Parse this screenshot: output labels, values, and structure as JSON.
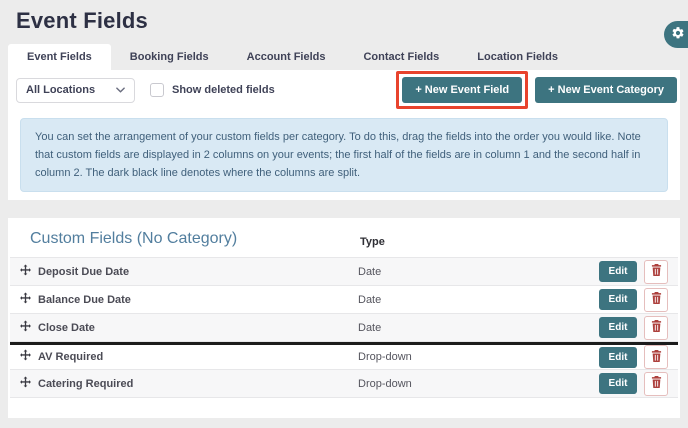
{
  "page": {
    "title": "Event Fields"
  },
  "tabs": [
    {
      "label": "Event Fields",
      "active": true
    },
    {
      "label": "Booking Fields",
      "active": false
    },
    {
      "label": "Account Fields",
      "active": false
    },
    {
      "label": "Contact Fields",
      "active": false
    },
    {
      "label": "Location Fields",
      "active": false
    }
  ],
  "toolbar": {
    "location_select_value": "All Locations",
    "show_deleted_label": "Show deleted fields",
    "show_deleted_checked": false,
    "new_event_field_label": "+ New Event Field",
    "new_event_category_label": "+ New Event Category"
  },
  "info_banner": {
    "text": "You can set the arrangement of your custom fields per category. To do this, drag the fields into the order you would like. Note that custom fields are displayed in 2 columns on your events; the first half of the fields are in column 1 and the second half in column 2. The dark black line denotes where the columns are split."
  },
  "table": {
    "title": "Custom Fields (No Category)",
    "type_header": "Type",
    "edit_label": "Edit",
    "rows": [
      {
        "name": "Deposit Due Date",
        "type": "Date"
      },
      {
        "name": "Balance Due Date",
        "type": "Date"
      },
      {
        "name": "Close Date",
        "type": "Date"
      },
      {
        "name": "AV Required",
        "type": "Drop-down"
      },
      {
        "name": "Catering Required",
        "type": "Drop-down"
      }
    ],
    "column_split_after_row": 3
  },
  "icons": {
    "settings_button": "gear-icon",
    "location_select": "chevron-down-icon",
    "drag_handle": "move-icon",
    "delete_button": "trash-icon"
  },
  "colors": {
    "accent_teal": "#3d7480",
    "highlight_red": "#e8432d",
    "danger_red": "#ad403d",
    "info_banner_bg": "#d9e9f4",
    "page_bg": "#ececec",
    "title_navy": "#2d3044",
    "split_line": "#1c1c1c"
  }
}
